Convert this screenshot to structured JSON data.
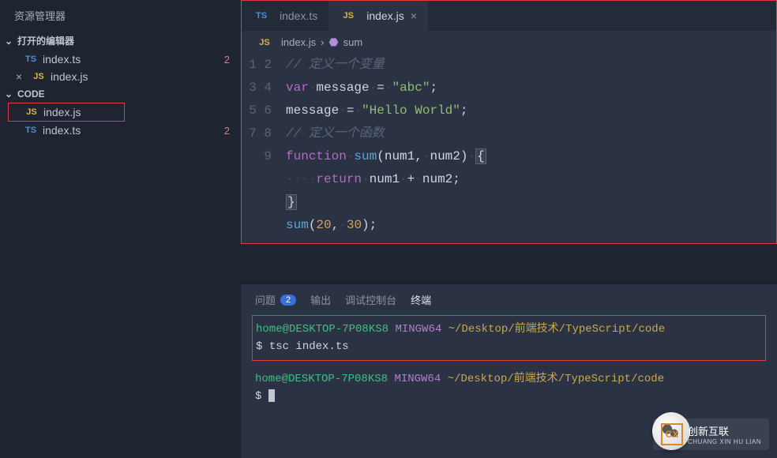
{
  "sidebar": {
    "title": "资源管理器",
    "open_editors_label": "打开的编辑器",
    "open_editors": [
      {
        "icon": "TS",
        "icon_class": "ts",
        "name": "index.ts",
        "badge": "2",
        "closable": false
      },
      {
        "icon": "JS",
        "icon_class": "js",
        "name": "index.js",
        "badge": "",
        "closable": true
      }
    ],
    "folder_label": "CODE",
    "files": [
      {
        "icon": "JS",
        "icon_class": "js",
        "name": "index.js",
        "badge": "",
        "highlight": true
      },
      {
        "icon": "TS",
        "icon_class": "ts",
        "name": "index.ts",
        "badge": "2",
        "highlight": false
      }
    ]
  },
  "tabs": [
    {
      "icon": "TS",
      "icon_class": "ts",
      "label": "index.ts",
      "active": false
    },
    {
      "icon": "JS",
      "icon_class": "js",
      "label": "index.js",
      "active": true
    }
  ],
  "breadcrumb": {
    "file_icon": "JS",
    "file": "index.js",
    "symbol": "sum"
  },
  "code": {
    "line1_comment": "// 定义一个变量",
    "line2_kw": "var",
    "line2_var": "message",
    "line2_eq": "=",
    "line2_str": "\"abc\"",
    "line3_var": "message",
    "line3_eq": "=",
    "line3_str": "\"Hello World\"",
    "line4_comment": "// 定义一个函数",
    "line5_kw": "function",
    "line5_fn": "sum",
    "line5_p1": "num1",
    "line5_p2": "num2",
    "line6_kw": "return",
    "line6_a": "num1",
    "line6_op": "+",
    "line6_b": "num2",
    "line7_close": "}",
    "line8_fn": "sum",
    "line8_a": "20",
    "line8_b": "30"
  },
  "panel": {
    "tabs": {
      "problems": "问题",
      "problems_count": "2",
      "output": "输出",
      "debug": "调试控制台",
      "terminal": "终端"
    },
    "term": {
      "user": "home@DESKTOP-7P08KS8",
      "env": "MINGW64",
      "path": "~/Desktop/前端技术/TypeScript/code",
      "prompt": "$",
      "cmd": "tsc index.ts"
    }
  },
  "brand": {
    "name": "创新互联",
    "sub": "CHUANG XIN HU LIAN",
    "logo": "CX"
  }
}
